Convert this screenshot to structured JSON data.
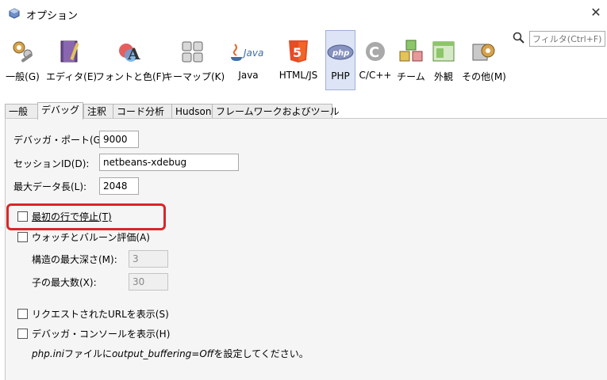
{
  "window": {
    "title": "オプション",
    "close_icon": "close-icon"
  },
  "toolbar": {
    "categories": [
      {
        "label": "一般(G)",
        "icon": "wrench-gears-icon"
      },
      {
        "label": "エディタ(E)",
        "icon": "notebook-pencil-icon"
      },
      {
        "label": "フォントと色(F)",
        "icon": "font-color-icon"
      },
      {
        "label": "キーマップ(K)",
        "icon": "keyboard-icon"
      },
      {
        "label": "Java",
        "icon": "java-icon"
      },
      {
        "label": "HTML/JS",
        "icon": "html5-icon"
      },
      {
        "label": "PHP",
        "icon": "php-icon",
        "selected": true
      },
      {
        "label": "C/C++",
        "icon": "cpp-icon"
      },
      {
        "label": "チーム",
        "icon": "team-blocks-icon"
      },
      {
        "label": "外観",
        "icon": "appearance-icon"
      },
      {
        "label": "その他(M)",
        "icon": "misc-gear-icon"
      }
    ]
  },
  "search": {
    "placeholder": "フィルタ(Ctrl+F)"
  },
  "tabs": [
    "一般",
    "デバッグ",
    "注釈",
    "コード分析",
    "Hudson",
    "フレームワークおよびツール"
  ],
  "active_tab": "デバッグ",
  "debug": {
    "port_label": "デバッガ・ポート(G):",
    "port_value": "9000",
    "session_label": "セッションID(D):",
    "session_value": "netbeans-xdebug",
    "maxlen_label": "最大データ長(L):",
    "maxlen_value": "2048",
    "stop_first_line": "最初の行で停止(T)",
    "watches": "ウォッチとバルーン評価(A)",
    "depth_label": "構造の最大深さ(M):",
    "depth_value": "3",
    "children_label": "子の最大数(X):",
    "children_value": "30",
    "show_url": "リクエストされたURLを表示(S)",
    "show_console": "デバッガ・コンソールを表示(H)",
    "note_prefix": "php.ini",
    "note_mid1": "ファイルに",
    "note_code": "output_buffering=Off",
    "note_suffix": "を設定してください。"
  },
  "colors": {
    "highlight": "#d9262a",
    "selected_tab_bg": "#dde4f5"
  }
}
